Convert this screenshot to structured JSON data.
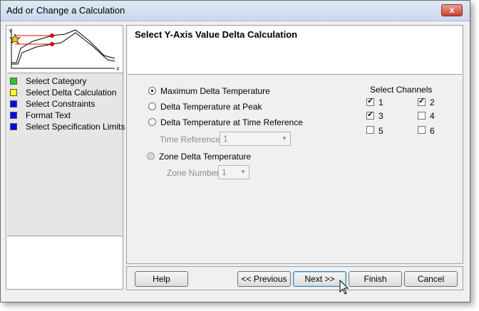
{
  "window": {
    "title": "Add or Change a Calculation",
    "close_glyph": "x"
  },
  "thumbnail": {
    "y_axis": "Y",
    "x_axis": "X",
    "icon": "star-icon"
  },
  "steps": [
    {
      "label": "Select Category",
      "color": "#22cc22"
    },
    {
      "label": "Select Delta Calculation",
      "color": "#ffff00"
    },
    {
      "label": "Select Constraints",
      "color": "#0000ff"
    },
    {
      "label": "Format Text",
      "color": "#0000ff"
    },
    {
      "label": "Select Specification Limits",
      "color": "#0000ff"
    }
  ],
  "header": {
    "title": "Select Y-Axis Value Delta Calculation"
  },
  "options": {
    "max_delta": "Maximum Delta Temperature",
    "delta_peak": "Delta Temperature at Peak",
    "delta_time_ref": "Delta Temperature at Time Reference",
    "zone_delta": "Zone Delta Temperature",
    "selected": "Maximum Delta Temperature"
  },
  "time_reference": {
    "label": "Time Reference",
    "value": "1"
  },
  "zone_number": {
    "label": "Zone Number",
    "value": "1"
  },
  "channels": {
    "title": "Select Channels",
    "items": [
      {
        "label": "1",
        "checked": true
      },
      {
        "label": "2",
        "checked": true
      },
      {
        "label": "3",
        "checked": true
      },
      {
        "label": "4",
        "checked": false
      },
      {
        "label": "5",
        "checked": false
      },
      {
        "label": "6",
        "checked": false
      }
    ]
  },
  "buttons": {
    "help": "Help",
    "previous": "<< Previous",
    "next": "Next >>",
    "finish": "Finish",
    "cancel": "Cancel"
  }
}
